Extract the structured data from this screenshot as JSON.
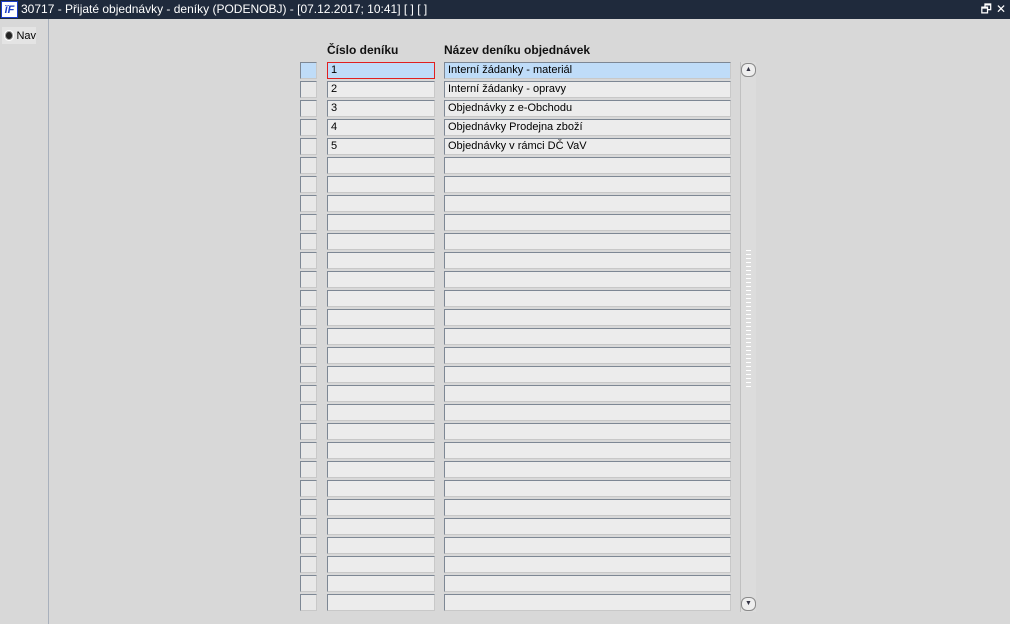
{
  "titlebar": {
    "logo": "IF",
    "title": "30717 - Přijaté objednávky - deníky (PODENOBJ) - [07.12.2017; 10:41]  [ ]  [ ]",
    "restore_icon": "restore-icon",
    "close_icon": "close-icon"
  },
  "nav": {
    "label": "Nav"
  },
  "columns": {
    "number": "Číslo deníku",
    "name": "Název deníku objednávek"
  },
  "rows": [
    {
      "number": "1",
      "name": "Interní žádanky - materiál"
    },
    {
      "number": "2",
      "name": "Interní žádanky - opravy"
    },
    {
      "number": "3",
      "name": "Objednávky z e-Obchodu"
    },
    {
      "number": "4",
      "name": "Objednávky Prodejna zboží"
    },
    {
      "number": "5",
      "name": "Objednávky v rámci DČ VaV"
    },
    {
      "number": "",
      "name": ""
    },
    {
      "number": "",
      "name": ""
    },
    {
      "number": "",
      "name": ""
    },
    {
      "number": "",
      "name": ""
    },
    {
      "number": "",
      "name": ""
    },
    {
      "number": "",
      "name": ""
    },
    {
      "number": "",
      "name": ""
    },
    {
      "number": "",
      "name": ""
    },
    {
      "number": "",
      "name": ""
    },
    {
      "number": "",
      "name": ""
    },
    {
      "number": "",
      "name": ""
    },
    {
      "number": "",
      "name": ""
    },
    {
      "number": "",
      "name": ""
    },
    {
      "number": "",
      "name": ""
    },
    {
      "number": "",
      "name": ""
    },
    {
      "number": "",
      "name": ""
    },
    {
      "number": "",
      "name": ""
    },
    {
      "number": "",
      "name": ""
    },
    {
      "number": "",
      "name": ""
    },
    {
      "number": "",
      "name": ""
    },
    {
      "number": "",
      "name": ""
    },
    {
      "number": "",
      "name": ""
    },
    {
      "number": "",
      "name": ""
    },
    {
      "number": "",
      "name": ""
    }
  ]
}
